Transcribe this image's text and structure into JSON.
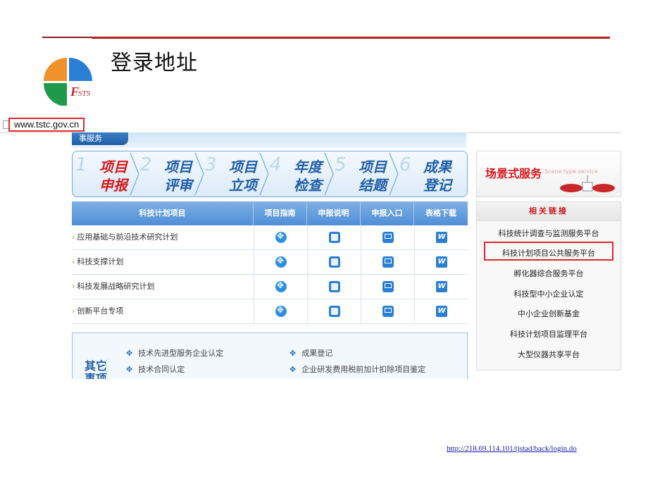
{
  "slide": {
    "title": "登录地址",
    "logo_text": "FSTS",
    "footer_link": "http://218.69.114.101/tjstad/back/login.do"
  },
  "screenshot": {
    "url": "www.tstc.gov.cn",
    "service_tab": "事服务",
    "steps": [
      {
        "num": "1",
        "line1": "项目",
        "line2": "申报",
        "active": true
      },
      {
        "num": "2",
        "line1": "项目",
        "line2": "评审",
        "active": false
      },
      {
        "num": "3",
        "line1": "项目",
        "line2": "立项",
        "active": false
      },
      {
        "num": "4",
        "line1": "年度",
        "line2": "检查",
        "active": false
      },
      {
        "num": "5",
        "line1": "项目",
        "line2": "结题",
        "active": false
      },
      {
        "num": "6",
        "line1": "成果",
        "line2": "登记",
        "active": false
      }
    ],
    "table": {
      "headers": [
        "科技计划项目",
        "项目指南",
        "申报说明",
        "申报入口",
        "表格下载"
      ],
      "rows": [
        "应用基础与前沿技术研究计划",
        "科技支撑计划",
        "科技发展战略研究计划",
        "创新平台专项"
      ]
    },
    "other": {
      "title": "其它事项",
      "items": [
        "技术先进型服务企业认定",
        "技术合同认定",
        "成果登记",
        "企业研发费用税前加计扣除项目鉴定"
      ]
    },
    "right_banner": {
      "title": "场景式服务",
      "subtitle": "Scene type service"
    },
    "links": {
      "heading": "相关链接",
      "items": [
        "科技统计调查与监测服务平台",
        "科技计划项目公共服务平台",
        "孵化器综合服务平台",
        "科技型中小企业认定",
        "中小企业创新基金",
        "科技计划项目监理平台",
        "大型仪器共享平台"
      ]
    }
  }
}
